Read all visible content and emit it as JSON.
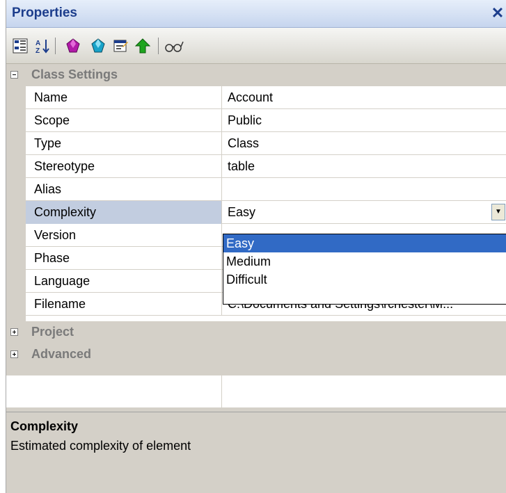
{
  "window": {
    "title": "Properties",
    "close_glyph": "✕"
  },
  "toolbar": {
    "buttons": [
      {
        "icon": "categorized-view-icon"
      },
      {
        "icon": "alphabetical-sort-icon"
      },
      {
        "icon": "purple-gem-icon"
      },
      {
        "icon": "cyan-gem-icon"
      },
      {
        "icon": "property-pages-icon"
      },
      {
        "icon": "green-up-arrow-icon"
      },
      {
        "icon": "spectacles-icon"
      }
    ]
  },
  "categories": {
    "class_settings": "Class Settings",
    "project": "Project",
    "advanced": "Advanced"
  },
  "properties": [
    {
      "name": "Name",
      "value": "Account"
    },
    {
      "name": "Scope",
      "value": "Public"
    },
    {
      "name": "Type",
      "value": "Class"
    },
    {
      "name": "Stereotype",
      "value": "table"
    },
    {
      "name": "Alias",
      "value": ""
    },
    {
      "name": "Complexity",
      "value": "Easy"
    },
    {
      "name": "Version",
      "value": ""
    },
    {
      "name": "Phase",
      "value": ""
    },
    {
      "name": "Language",
      "value": ""
    },
    {
      "name": "Filename",
      "value": "C:\\Documents and Settings\\rchester\\M..."
    }
  ],
  "dropdown": {
    "options": [
      "Easy",
      "Medium",
      "Difficult"
    ],
    "highlighted": "Easy"
  },
  "help": {
    "title": "Complexity",
    "description": "Estimated complexity of element"
  },
  "colors": {
    "selection": "#316ac5",
    "title_text": "#1c3d8c",
    "panel": "#d4d0c8"
  }
}
